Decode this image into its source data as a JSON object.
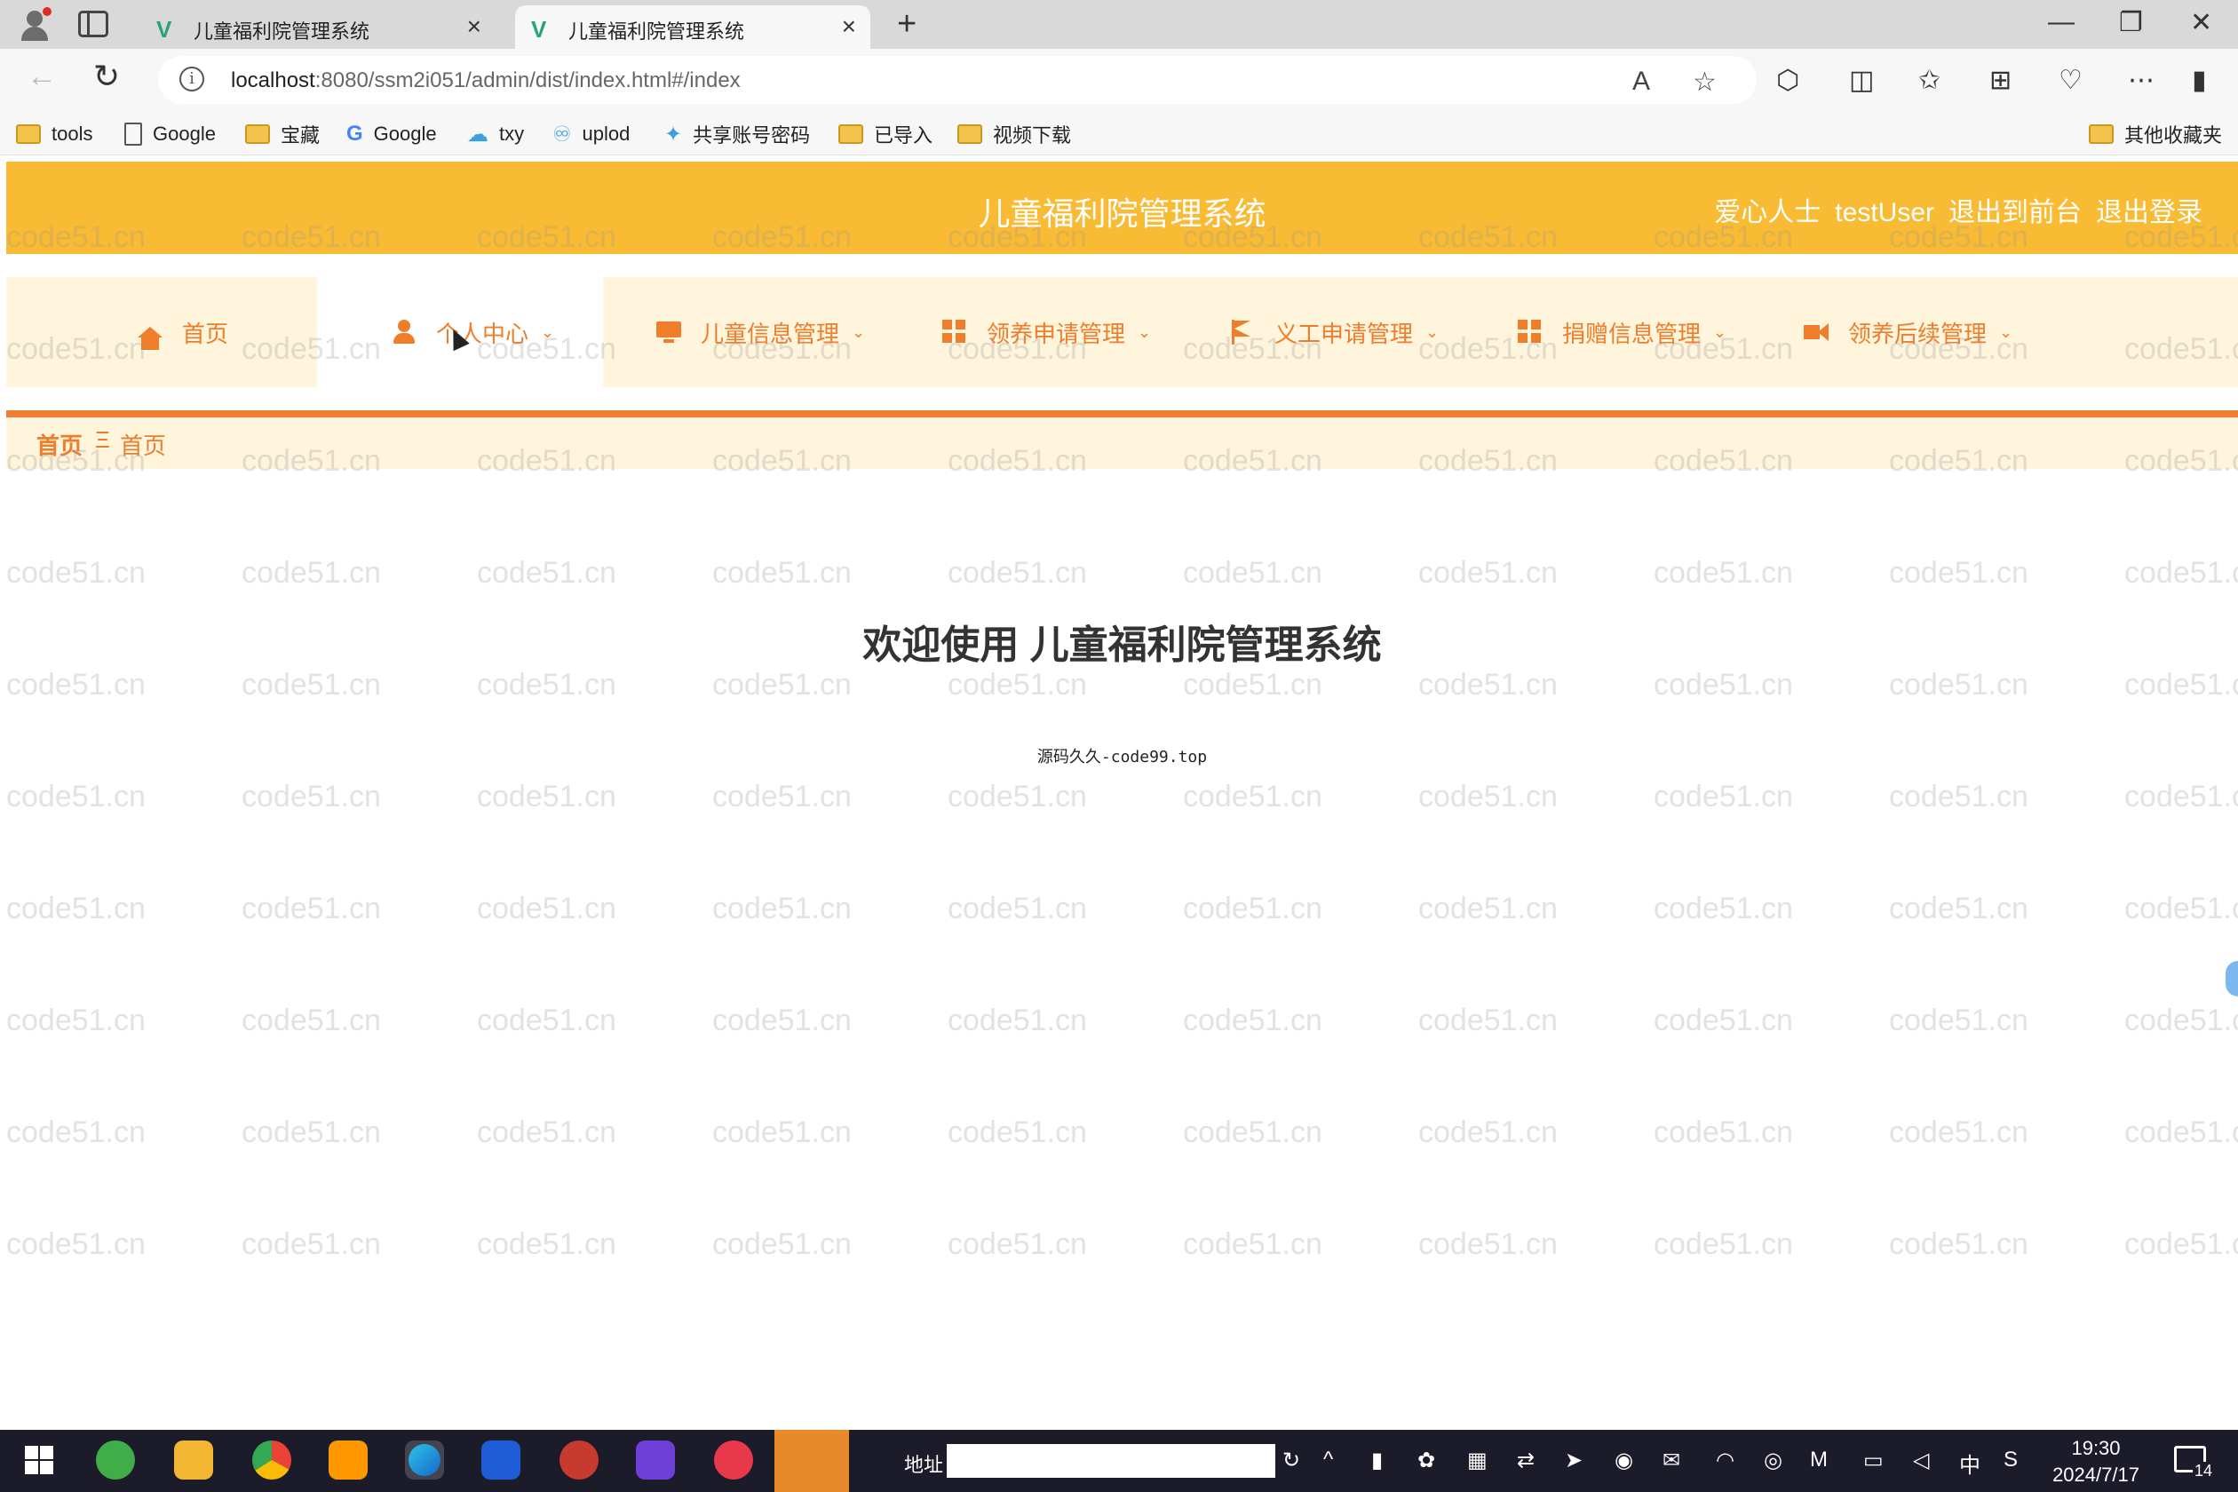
{
  "browser": {
    "tabs": [
      {
        "title": "儿童福利院管理系统",
        "active": false
      },
      {
        "title": "儿童福利院管理系统",
        "active": true
      }
    ],
    "url_host": "localhost",
    "url_path": ":8080/ssm2i051/admin/dist/index.html#/index",
    "bookmarks": [
      "tools",
      "Google",
      "宝藏",
      "Google",
      "txy",
      "uplod",
      "共享账号密码",
      "已导入",
      "视频下载"
    ],
    "other_bookmarks": "其他收藏夹"
  },
  "header": {
    "system_title": "儿童福利院管理系统",
    "role": "爱心人士",
    "username": "testUser",
    "back_to_front": "退出到前台",
    "logout": "退出登录"
  },
  "menu": [
    {
      "label": "首页",
      "icon": "home-icon",
      "dropdown": false,
      "active": false
    },
    {
      "label": "个人中心",
      "icon": "user-icon",
      "dropdown": true,
      "active": true
    },
    {
      "label": "儿童信息管理",
      "icon": "monitor-icon",
      "dropdown": true,
      "active": false
    },
    {
      "label": "领养申请管理",
      "icon": "grid-icon",
      "dropdown": true,
      "active": false
    },
    {
      "label": "义工申请管理",
      "icon": "flag-icon",
      "dropdown": true,
      "active": false
    },
    {
      "label": "捐赠信息管理",
      "icon": "grid-icon",
      "dropdown": true,
      "active": false
    },
    {
      "label": "领养后续管理",
      "icon": "video-icon",
      "dropdown": true,
      "active": false
    }
  ],
  "breadcrumb": {
    "home": "首页",
    "separator": "Ξ",
    "current": "首页"
  },
  "main": {
    "welcome": "欢迎使用 儿童福利院管理系统",
    "subline": "源码久久-code99.top"
  },
  "watermark": "code51.cn",
  "taskbar": {
    "address_label": "地址",
    "ime": "中",
    "time": "19:30",
    "date": "2024/7/17",
    "notification_count": "14"
  },
  "colors": {
    "header_bg": "#f8bb33",
    "menu_bg": "#fff4dc",
    "menu_text": "#f07d2a",
    "accent_line": "#ef7d33"
  }
}
